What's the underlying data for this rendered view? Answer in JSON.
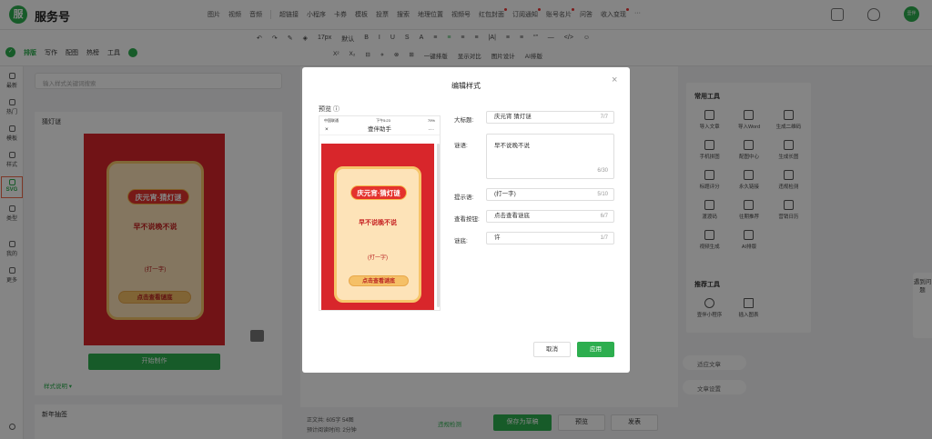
{
  "app": {
    "logo_text": "服",
    "title": "服务号"
  },
  "topnav": {
    "items": [
      "图片",
      "视频",
      "音频",
      "超链接",
      "小程序",
      "卡券",
      "模板",
      "投票",
      "搜索",
      "地理位置",
      "视频号",
      "红包封面",
      "订阅通知",
      "账号名片",
      "问答",
      "收入变现",
      "···"
    ],
    "avatar_text": "壹伴"
  },
  "toolbar": {
    "tabs": [
      "排版",
      "写作",
      "配图",
      "热榜",
      "工具"
    ],
    "row1": [
      "↶",
      "↷",
      "✎",
      "◈",
      "17px",
      "默认",
      "B",
      "I",
      "U",
      "S",
      "A",
      "≡",
      "≡",
      "≡",
      "≡",
      "|A|",
      "≡",
      "≡",
      "“”",
      "—",
      "</>",
      "☺"
    ],
    "row2": [
      "X²",
      "X₂",
      "⊟",
      "⋄",
      "⊗",
      "⊞",
      "一键排版",
      "显示对比",
      "图片设计",
      "AI排版"
    ]
  },
  "sidenav": {
    "items": [
      "最新",
      "热门",
      "模板",
      "样式",
      "SVG",
      "类型",
      "我的",
      "更多"
    ]
  },
  "panel": {
    "search_placeholder": "输入样式关键词搜索",
    "card1_title": "猜灯谜",
    "poster_title": "庆元宵·猜灯谜",
    "poster_riddle": "早不说晚不说",
    "poster_hint": "(打一字)",
    "poster_button": "点击查看谜底",
    "start_button": "开始制作",
    "style_link": "样式说明 ▾",
    "card2_title": "新年抽签"
  },
  "right_panel": {
    "title": "常用工具",
    "tools": [
      "导入文章",
      "导入Word",
      "生成二维码",
      "手机拼图",
      "配图中心",
      "生成长图",
      "标题评分",
      "永久链接",
      "违规检测",
      "渡渡码",
      "往期推荐",
      "营销日历",
      "视频生成",
      "AI排版"
    ],
    "recommend_title": "推荐工具",
    "recommend": [
      "壹伴小程序",
      "插入图表"
    ]
  },
  "sidebuttons": {
    "fit": "适应文章",
    "settings": "文章设置"
  },
  "feedback": "遇到问题",
  "bottombar": {
    "stats_line1": "正文共:   605字 54图",
    "stats_line2": "预计阅读时间:   2分钟",
    "check": "违规检测",
    "save_draft": "保存为草稿",
    "preview": "预览",
    "publish": "发表"
  },
  "modal": {
    "title": "编辑样式",
    "close": "×",
    "preview_label": "预览 ⓘ",
    "phone_status_left": "中国联通",
    "phone_status_mid": "下午5:23",
    "phone_status_right": "79%",
    "phone_header": "壹伴助手",
    "poster_title": "庆元宵·猜灯谜",
    "poster_riddle": "早不说晚不说",
    "poster_hint": "(打一字)",
    "poster_button": "点击查看谜底",
    "fields": {
      "title": {
        "label": "大标题:",
        "value": "庆元宵 猜灯谜",
        "count": "7/7"
      },
      "riddle": {
        "label": "谜语:",
        "value": "早不说晚不说",
        "count": "6/30"
      },
      "hint": {
        "label": "提示语:",
        "value": "(打一字)",
        "count": "5/10"
      },
      "button": {
        "label": "查看按钮:",
        "value": "点击查看谜底",
        "count": "6/7"
      },
      "answer": {
        "label": "谜底:",
        "value": "许",
        "count": "1/7"
      }
    },
    "cancel": "取消",
    "apply": "应用"
  },
  "colors": {
    "accent": "#2dae4f",
    "poster_red": "#d8262b",
    "poster_cream": "#fde3b8",
    "svg_highlight": "#f06a4b"
  }
}
